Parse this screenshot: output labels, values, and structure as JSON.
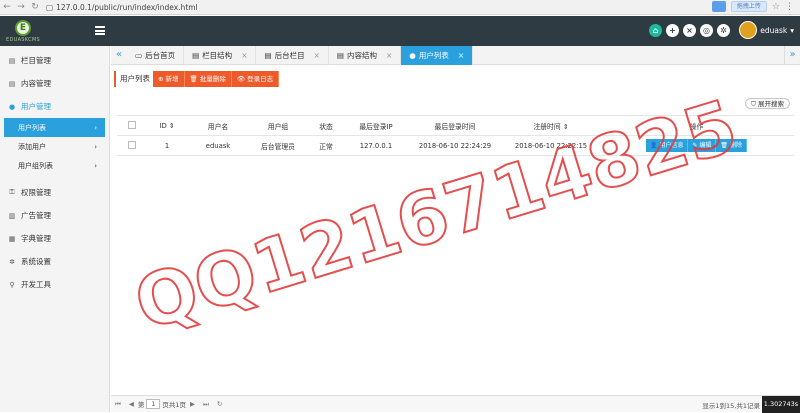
{
  "browser": {
    "url": "127.0.0.1/public/run/index/index.html",
    "upload_label": "拖拽上传"
  },
  "logo": {
    "text": "EDUASKCMS",
    "badge": "E"
  },
  "user": {
    "name": "eduask"
  },
  "sidebar": {
    "items": [
      {
        "label": "栏目管理",
        "icon": "file-icon"
      },
      {
        "label": "内容管理",
        "icon": "file-icon"
      },
      {
        "label": "用户管理",
        "icon": "user-icon"
      },
      {
        "label": "权限管理",
        "icon": "key-icon"
      },
      {
        "label": "广告管理",
        "icon": "chart-icon"
      },
      {
        "label": "字典管理",
        "icon": "book-icon"
      },
      {
        "label": "系统设置",
        "icon": "gear-icon"
      },
      {
        "label": "开发工具",
        "icon": "search-icon"
      }
    ],
    "subitems": [
      {
        "label": "用户列表"
      },
      {
        "label": "添加用户"
      },
      {
        "label": "用户组列表"
      }
    ]
  },
  "tabs": [
    {
      "label": "后台首页"
    },
    {
      "label": "栏目结构"
    },
    {
      "label": "后台栏目"
    },
    {
      "label": "内容结构"
    },
    {
      "label": "用户列表"
    }
  ],
  "toolbar": {
    "list_label": "用户列表",
    "add": "新增",
    "batch_delete": "批量删除",
    "login_log": "登录日志"
  },
  "search_toggle": "展开搜索",
  "table": {
    "headers": [
      "ID",
      "用户名",
      "用户组",
      "状态",
      "最后登录IP",
      "最后登录时间",
      "注册时间",
      "操作"
    ],
    "rows": [
      {
        "id": "1",
        "username": "eduask",
        "group": "后台管理员",
        "status": "正常",
        "ip": "127.0.0.1",
        "last_login": "2018-06-10 22:24:29",
        "registered": "2018-06-10 22:22:15"
      }
    ],
    "actions": {
      "info": "用户信息",
      "edit": "编辑",
      "delete": "删除"
    }
  },
  "pager": {
    "page_prefix": "第",
    "page": "1",
    "page_suffix": "页共1页",
    "info": "显示1到15,共1记录"
  },
  "timer": "1.302743s",
  "watermark": "QQ1216714825",
  "colors": {
    "accent": "#2aa0dc",
    "toolbar": "#ef5a2a",
    "topbar": "#2f3b42",
    "watermark": "#e23b3b"
  }
}
